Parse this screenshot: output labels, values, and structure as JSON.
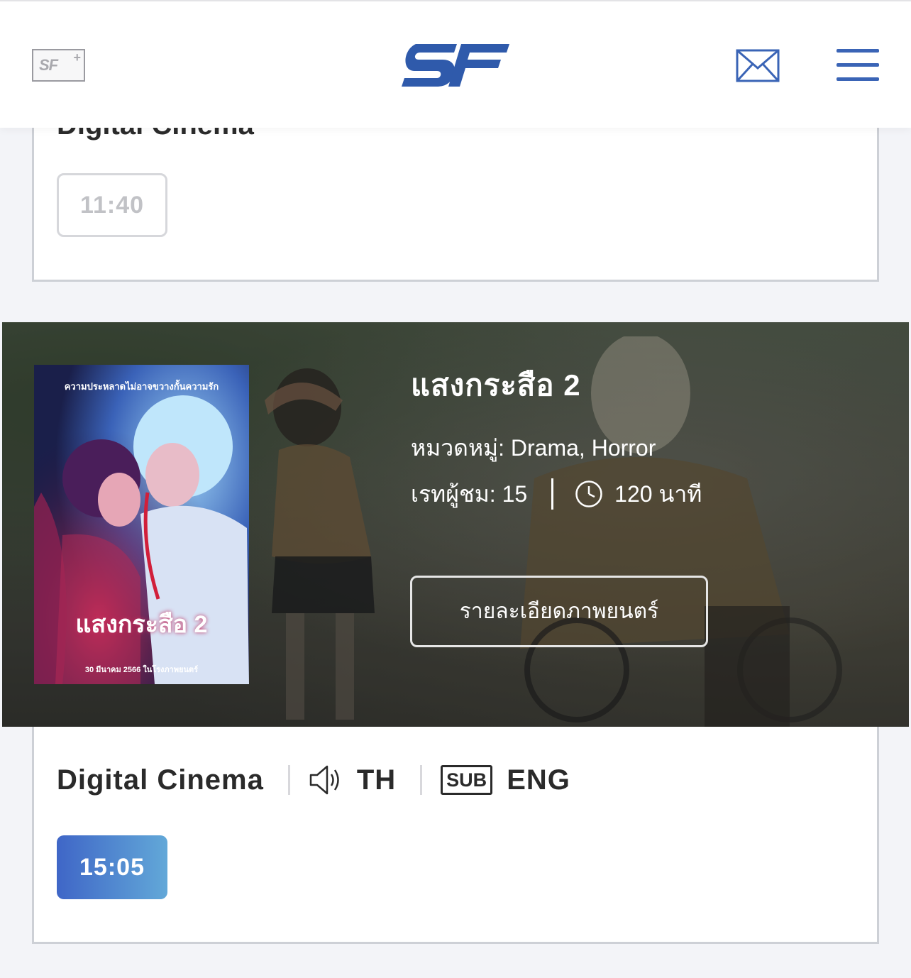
{
  "header": {
    "sfplus_label": "SF",
    "sfplus_sup": "+",
    "logo_name": "SF",
    "mail_icon": "mail-icon",
    "menu_icon": "hamburger-menu-icon",
    "brand_color": "#3a64b6"
  },
  "showtime_card_1": {
    "format": "Digital Cinema",
    "times": [
      "11:40"
    ]
  },
  "movie": {
    "poster_tagline": "ความประหลาดไม่อาจขวางกั้นความรัก",
    "poster_title": "แสงกระสือ 2",
    "poster_date": "30 มีนาคม 2566 ในโรงภาพยนตร์",
    "title": "แสงกระสือ 2",
    "genre": "หมวดหมู่: Drama, Horror",
    "rating": "เรทผู้ชม: 15",
    "duration": "120 นาที",
    "detail_button": "รายละเอียดภาพยนตร์"
  },
  "showtime_card_2": {
    "format": "Digital Cinema",
    "audio_icon": "speaker-icon",
    "audio": "TH",
    "subtitle_badge": "SUB",
    "subtitle": "ENG",
    "times": [
      "15:05"
    ],
    "selected_time_gradient": [
      "#3f66c7",
      "#62a8d8"
    ]
  }
}
